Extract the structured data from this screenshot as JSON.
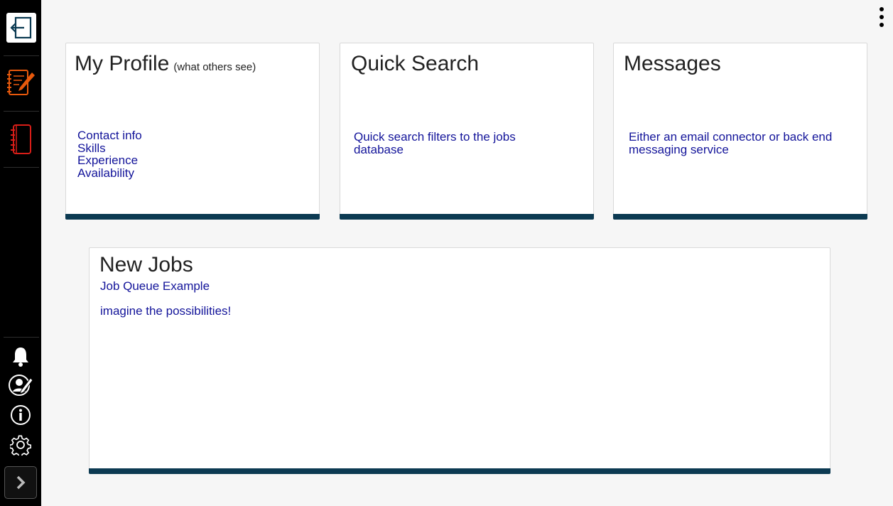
{
  "sidebar": {
    "exit_icon": "exit-icon",
    "top_items": [
      {
        "name": "notes-edit-icon",
        "color": "#e8590c"
      },
      {
        "name": "notebook-icon",
        "color": "#d91e18"
      }
    ],
    "bottom_items": [
      "bell-icon",
      "user-edit-icon",
      "info-icon",
      "gear-icon"
    ],
    "collapse_icon": "chevron-right-icon"
  },
  "menu_icon": "kebab-menu-icon",
  "cards": {
    "profile": {
      "title": "My Profile",
      "subtitle": "(what others see)",
      "items": [
        "Contact info",
        "Skills",
        "Experience",
        "Availability"
      ]
    },
    "quick_search": {
      "title": "Quick Search",
      "description": "Quick search filters to the jobs database"
    },
    "messages": {
      "title": "Messages",
      "description": "Either an email connector or back end messaging service"
    },
    "new_jobs": {
      "title": "New Jobs",
      "subtitle": "Job Queue Example",
      "note": "imagine the possibilities!"
    }
  },
  "colors": {
    "accent_bar": "#0c3a52",
    "link_text": "#13149a",
    "sidebar_bg": "#000000"
  }
}
